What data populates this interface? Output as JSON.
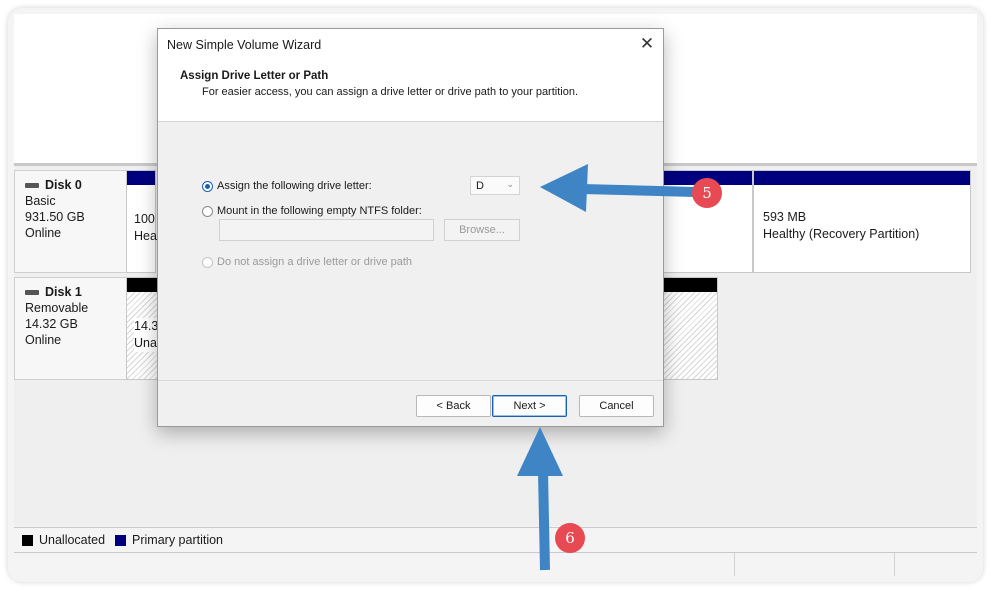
{
  "dialog": {
    "title": "New Simple Volume Wizard",
    "close_glyph": "✕",
    "heading": "Assign Drive Letter or Path",
    "subtitle": "For easier access, you can assign a drive letter or drive path to your partition.",
    "option_assign_letter": "Assign the following drive letter:",
    "drive_letter_value": "D",
    "option_mount_folder": "Mount in the following empty NTFS folder:",
    "browse_label": "Browse...",
    "option_no_assign": "Do not assign a drive letter or drive path",
    "back_label": "< Back",
    "next_label": "Next >",
    "cancel_label": "Cancel"
  },
  "disks": [
    {
      "name": "Disk 0",
      "type": "Basic",
      "size": "931.50 GB",
      "status": "Online",
      "partitions": [
        {
          "size": "100",
          "status": "Heal"
        },
        {
          "size": "593 MB",
          "status": "Healthy (Recovery Partition)"
        }
      ]
    },
    {
      "name": "Disk 1",
      "type": "Removable",
      "size": "14.32 GB",
      "status": "Online",
      "partitions": [
        {
          "size": "14.3",
          "status": "Unal"
        }
      ]
    }
  ],
  "legend": {
    "unallocated": "Unallocated",
    "primary": "Primary partition"
  },
  "annotations": {
    "step5": "5",
    "step6": "6"
  },
  "colors": {
    "primary_partition": "#00007f",
    "unallocated": "#000000",
    "arrow": "#3f85c6",
    "badge": "#e84a54",
    "radio_selected": "#1a5fb4"
  }
}
